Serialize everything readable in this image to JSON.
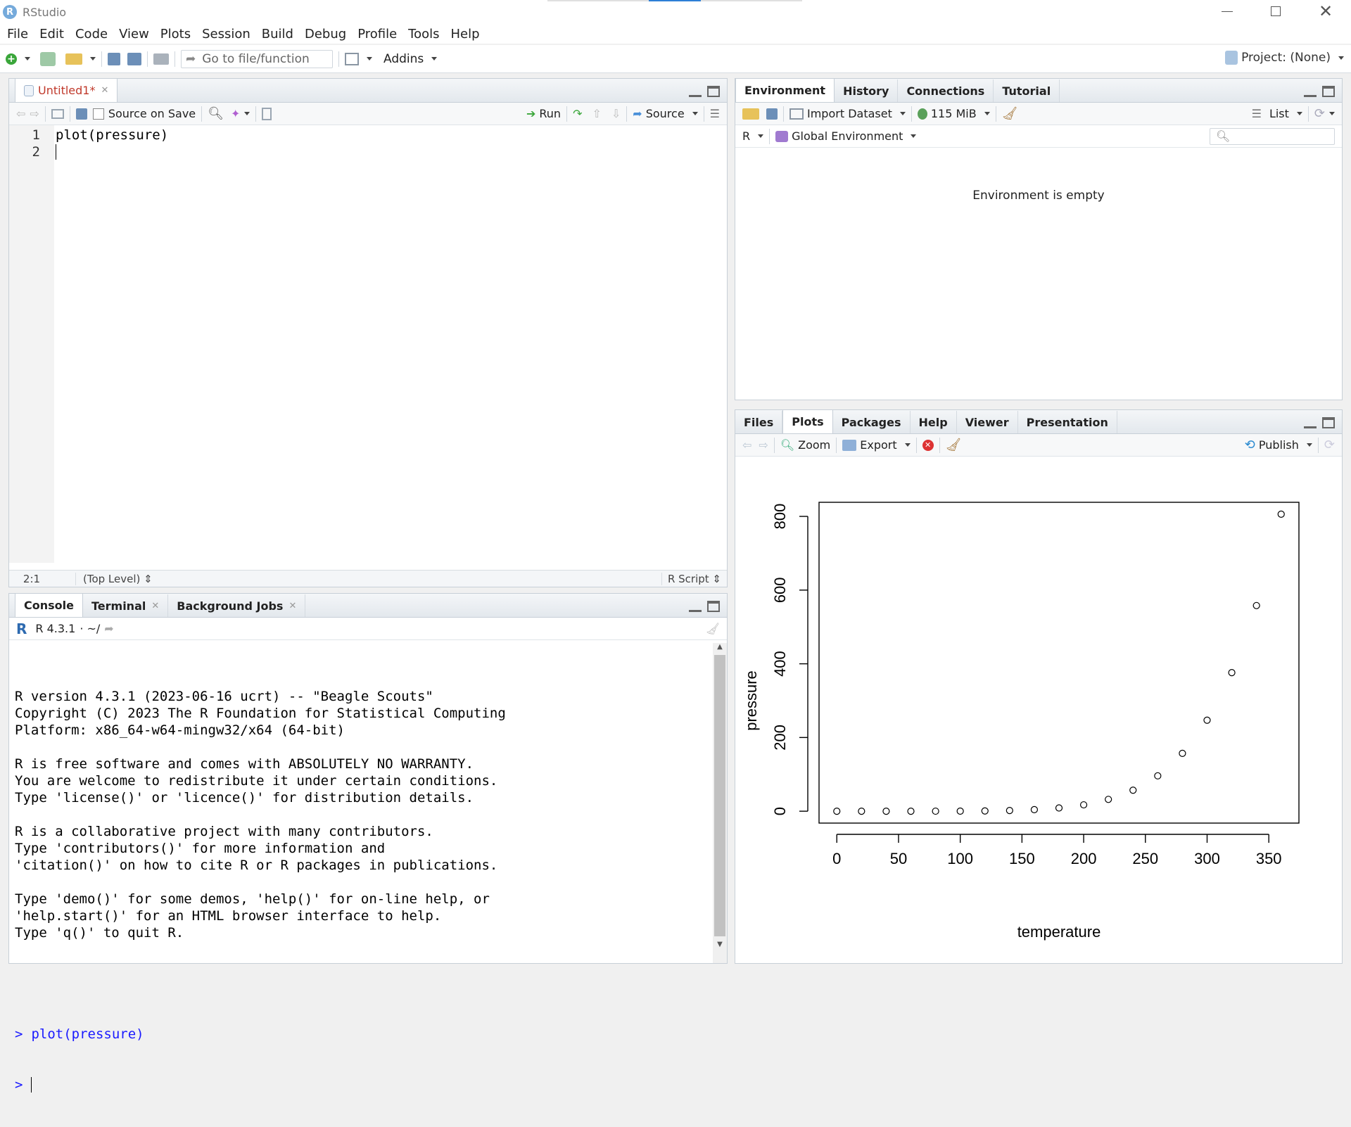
{
  "titlebar": {
    "app_title": "RStudio"
  },
  "menubar": [
    "File",
    "Edit",
    "Code",
    "View",
    "Plots",
    "Session",
    "Build",
    "Debug",
    "Profile",
    "Tools",
    "Help"
  ],
  "main_toolbar": {
    "goto_placeholder": "Go to file/function",
    "addins": "Addins",
    "project": "Project: (None)"
  },
  "editor": {
    "tab_label": "Untitled1*",
    "source_on_save": "Source on Save",
    "run": "Run",
    "source": "Source",
    "lines": [
      {
        "num": "1",
        "code": "plot(pressure)"
      },
      {
        "num": "2",
        "code": ""
      }
    ],
    "status_position": "2:1",
    "status_scope": "(Top Level)",
    "status_filetype": "R Script"
  },
  "console": {
    "tabs": [
      "Console",
      "Terminal",
      "Background Jobs"
    ],
    "r_version_label": "R 4.3.1",
    "path_label": "· ~/",
    "output": "R version 4.3.1 (2023-06-16 ucrt) -- \"Beagle Scouts\"\nCopyright (C) 2023 The R Foundation for Statistical Computing\nPlatform: x86_64-w64-mingw32/x64 (64-bit)\n\nR is free software and comes with ABSOLUTELY NO WARRANTY.\nYou are welcome to redistribute it under certain conditions.\nType 'license()' or 'licence()' for distribution details.\n\nR is a collaborative project with many contributors.\nType 'contributors()' for more information and\n'citation()' on how to cite R or R packages in publications.\n\nType 'demo()' for some demos, 'help()' for on-line help, or\n'help.start()' for an HTML browser interface to help.\nType 'q()' to quit R.",
    "prompt_symbol": ">",
    "last_command": "plot(pressure)"
  },
  "environment": {
    "tabs": [
      "Environment",
      "History",
      "Connections",
      "Tutorial"
    ],
    "import_dataset": "Import Dataset",
    "memory": "115 MiB",
    "view_mode": "List",
    "lang": "R",
    "scope": "Global Environment",
    "empty_message": "Environment is empty"
  },
  "files_panel": {
    "tabs": [
      "Files",
      "Plots",
      "Packages",
      "Help",
      "Viewer",
      "Presentation"
    ],
    "zoom": "Zoom",
    "export": "Export",
    "publish": "Publish"
  },
  "chart_data": {
    "type": "scatter",
    "title": "",
    "xlabel": "temperature",
    "ylabel": "pressure",
    "x": [
      0,
      20,
      40,
      60,
      80,
      100,
      120,
      140,
      160,
      180,
      200,
      220,
      240,
      260,
      280,
      300,
      320,
      340,
      360
    ],
    "y": [
      0.0002,
      0.0012,
      0.006,
      0.03,
      0.09,
      0.27,
      0.75,
      1.85,
      4.2,
      8.8,
      17.3,
      32.1,
      57,
      96,
      157,
      247,
      376,
      558,
      806
    ],
    "xticks": [
      0,
      50,
      100,
      150,
      200,
      250,
      300,
      350
    ],
    "yticks": [
      0,
      200,
      400,
      600,
      800
    ],
    "xlim": [
      -14.4,
      374.4
    ],
    "ylim": [
      -32.24,
      838.24
    ],
    "grid": false
  }
}
